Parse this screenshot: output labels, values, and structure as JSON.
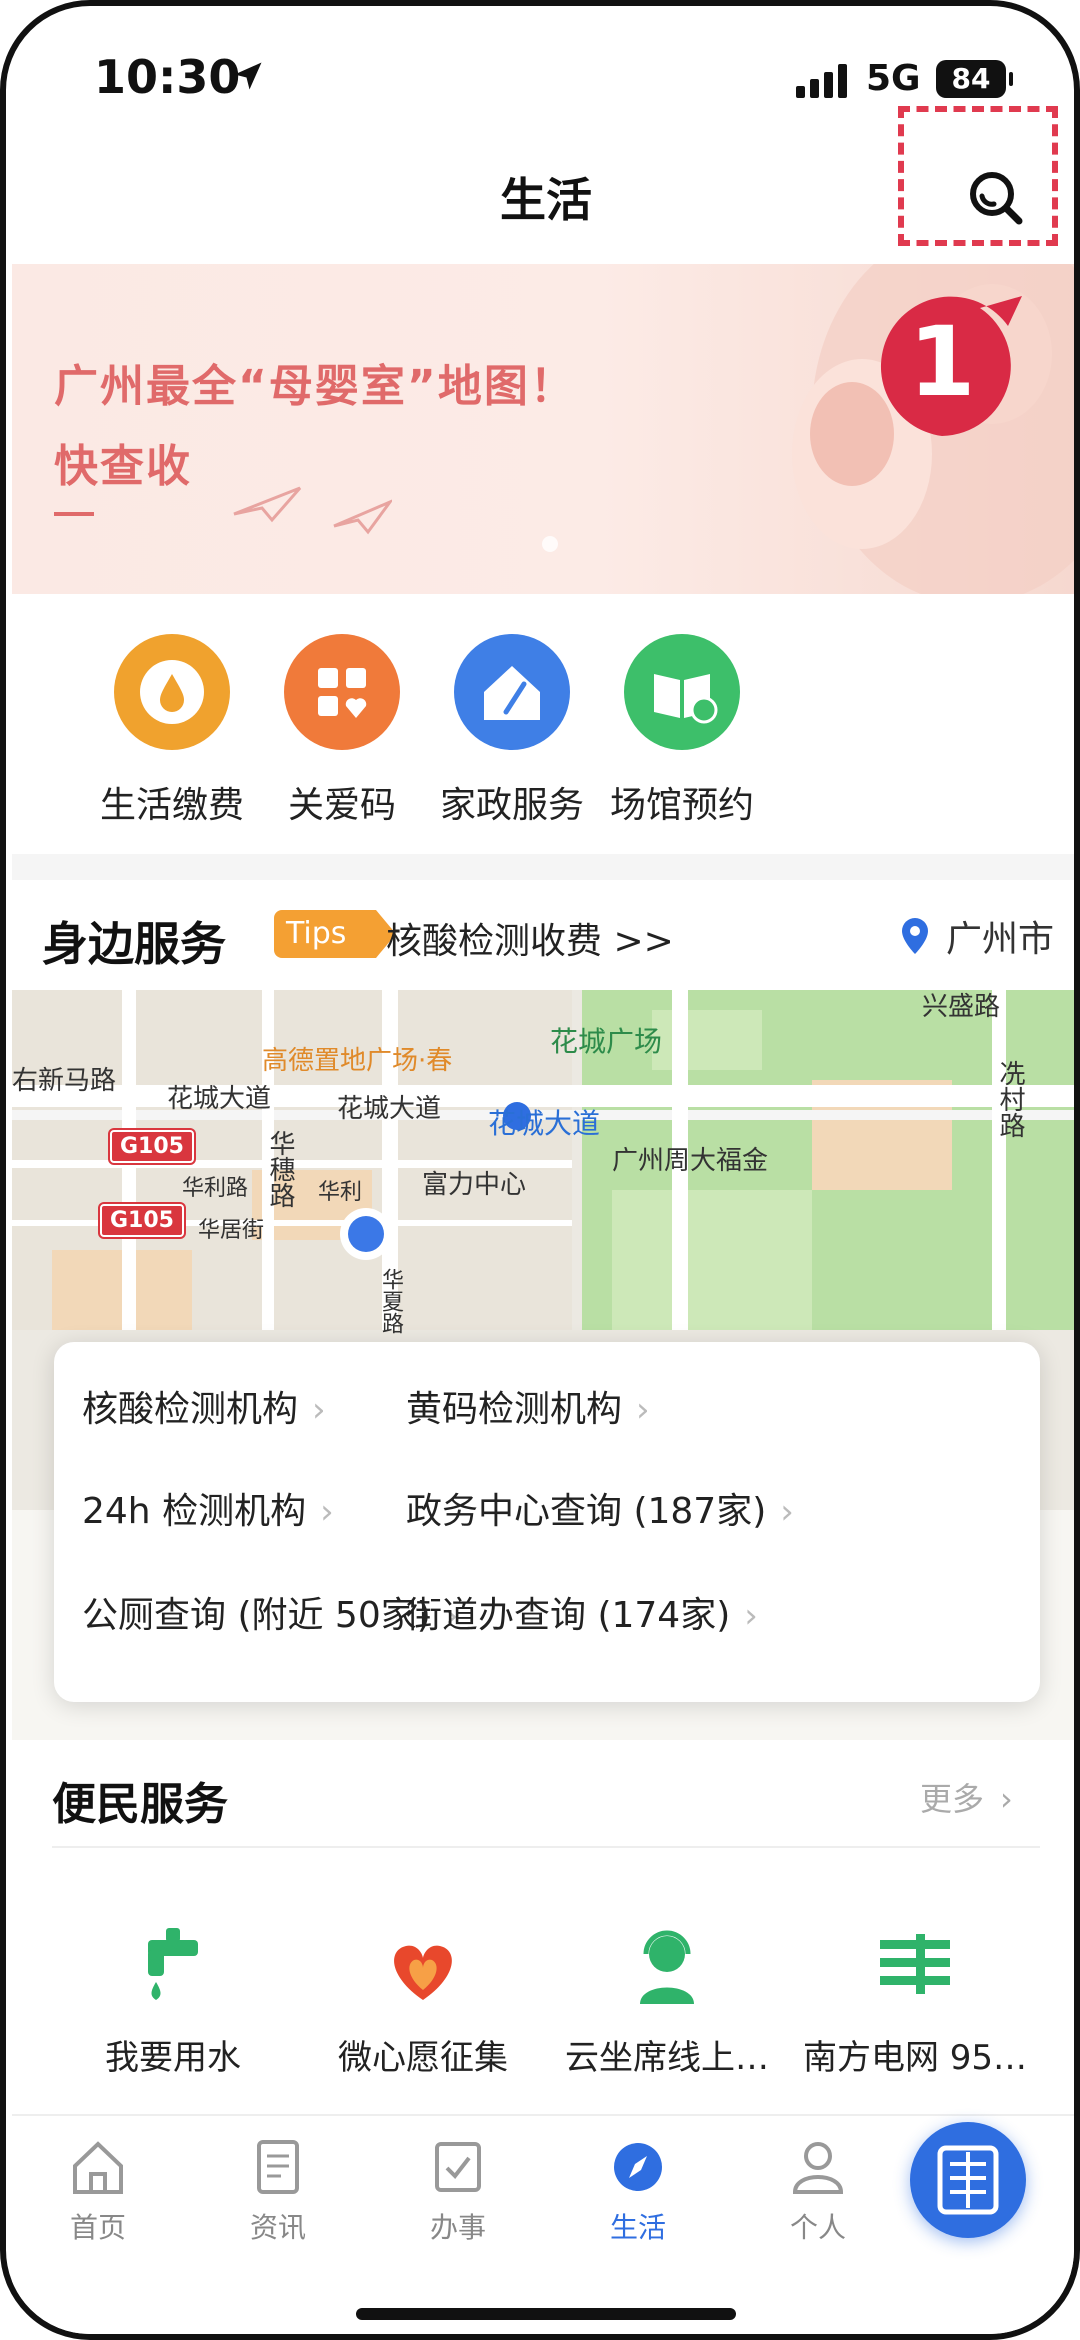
{
  "status_bar": {
    "time": "10:30",
    "network": "5G",
    "battery": "84"
  },
  "header": {
    "title": "生活"
  },
  "annotation": {
    "step_number": "1",
    "color": "#e03a4f"
  },
  "banner": {
    "line1": "广州最全“母婴室”地图！",
    "line2": "快查收"
  },
  "quick_services": [
    {
      "label": "生活缴费",
      "icon": "water-drop-icon",
      "color": "#f0a22e"
    },
    {
      "label": "关爱码",
      "icon": "qr-heart-icon",
      "color": "#f07a3a"
    },
    {
      "label": "家政服务",
      "icon": "house-broom-icon",
      "color": "#3f7fe6"
    },
    {
      "label": "场馆预约",
      "icon": "book-clock-icon",
      "color": "#3dbf6a"
    }
  ],
  "nearby": {
    "title": "身边服务",
    "tips_label": "Tips",
    "tips_link": "核酸检测收费 >>",
    "city": "广州市"
  },
  "map": {
    "labels": {
      "road1": "右新马路",
      "road2": "花城大道",
      "road3": "花城大道",
      "road4": "华穗路",
      "road5": "华利路",
      "road6": "华利",
      "road7": "华居街",
      "road8": "华夏路",
      "road9": "兴盛路",
      "road10": "冼村路",
      "poi1": "高德置地广场·春",
      "poi2": "花城广场",
      "poi3": "花城大道",
      "poi4": "富力中心",
      "poi5": "广州周大福金",
      "shield1": "G105",
      "shield2": "G105"
    }
  },
  "service_card": [
    {
      "label": "核酸检测机构"
    },
    {
      "label": "黄码检测机构"
    },
    {
      "label": "24h 检测机构"
    },
    {
      "label": "政务中心查询 (187家)"
    },
    {
      "label": "公厕查询 (附近 50家)"
    },
    {
      "label": "街道办查询 (174家)"
    }
  ],
  "convenience": {
    "title": "便民服务",
    "more": "更多",
    "items": [
      {
        "label": "我要用水",
        "icon": "tap-icon"
      },
      {
        "label": "微心愿征集",
        "icon": "heart-hands-icon"
      },
      {
        "label": "云坐席线上…",
        "icon": "agent-icon"
      },
      {
        "label": "南方电网 95…",
        "icon": "grid-icon"
      }
    ]
  },
  "tabbar": [
    {
      "label": "首页",
      "icon": "home-icon",
      "active": false
    },
    {
      "label": "资讯",
      "icon": "news-icon",
      "active": false
    },
    {
      "label": "办事",
      "icon": "task-icon",
      "active": false
    },
    {
      "label": "生活",
      "icon": "compass-icon",
      "active": true
    },
    {
      "label": "个人",
      "icon": "person-icon",
      "active": false
    }
  ],
  "fab": {
    "icon": "sui-logo-icon"
  }
}
